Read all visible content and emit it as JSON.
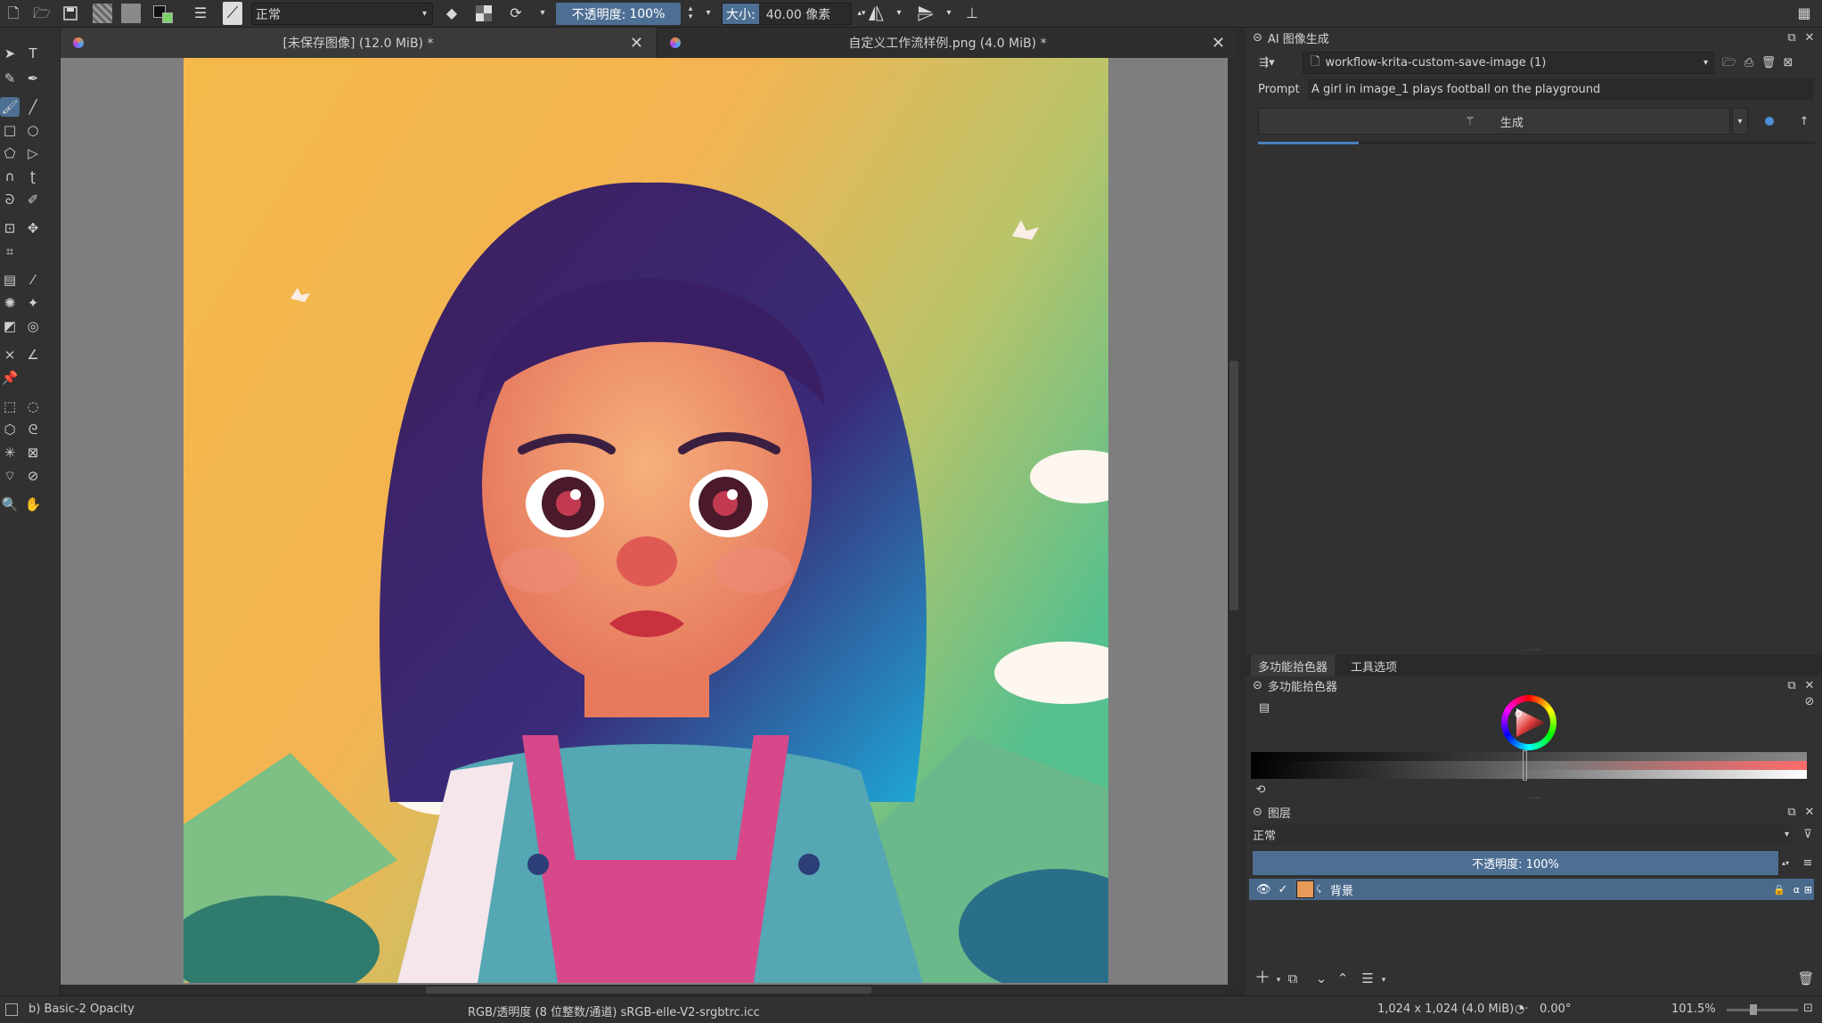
{
  "toolbar": {
    "blend_mode": "正常",
    "opacity_label": "不透明度:",
    "opacity_value": "100%",
    "size_label": "大小:",
    "size_value": "40.00 像素"
  },
  "tabs": [
    {
      "title": "[未保存图像] (12.0 MiB) *"
    },
    {
      "title": "自定义工作流样例.png (4.0 MiB) *"
    }
  ],
  "ai_panel": {
    "title": "AI 图像生成",
    "workflow": "workflow-krita-custom-save-image (1)",
    "prompt_label": "Prompt",
    "prompt_value": "A girl in image_1 plays football on the playground",
    "generate_label": "生成",
    "progress": 0.18
  },
  "dock_tabs": [
    "多功能拾色器",
    "工具选项"
  ],
  "color_panel": {
    "title": "多功能拾色器",
    "accent": "#e03c3c"
  },
  "layers_panel": {
    "title": "图层",
    "blend_mode": "正常",
    "opacity_label": "不透明度: 100%",
    "layers": [
      {
        "name": "背景",
        "visible": true,
        "checked": true
      }
    ]
  },
  "status": {
    "brush": "b) Basic-2 Opacity",
    "color_info": "RGB/透明度 (8 位整数/通道)  sRGB-elle-V2-srgbtrc.icc",
    "dimensions": "1,024 x 1,024 (4.0 MiB)",
    "rotation": "0.00°",
    "zoom": "101.5%"
  },
  "colors": {
    "accent": "#4e6f94",
    "selection": "#4a6a8c",
    "ui_bg": "#313131"
  }
}
